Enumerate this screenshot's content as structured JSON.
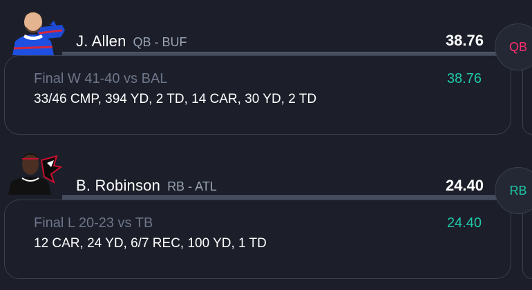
{
  "players": [
    {
      "name": "J. Allen",
      "position_team": "QB - BUF",
      "total_points": "38.76",
      "result": "Final W 41-40 vs BAL",
      "game_points": "38.76",
      "statline": "33/46 CMP, 394 YD, 2 TD, 14 CAR, 30 YD, 2 TD",
      "position_badge": "QB",
      "team_logo": "bills-logo-icon",
      "badge_color": "#ff2d6f"
    },
    {
      "name": "B. Robinson",
      "position_team": "RB - ATL",
      "total_points": "24.40",
      "result": "Final L 20-23 vs TB",
      "game_points": "24.40",
      "statline": "12 CAR, 24 YD, 6/7 REC, 100 YD, 1 TD",
      "position_badge": "RB",
      "team_logo": "falcons-logo-icon",
      "badge_color": "#1ec9a9"
    }
  ],
  "colors": {
    "background": "#1c1f2a",
    "points_accent": "#1ec9a9",
    "muted_text": "#6d7588"
  }
}
